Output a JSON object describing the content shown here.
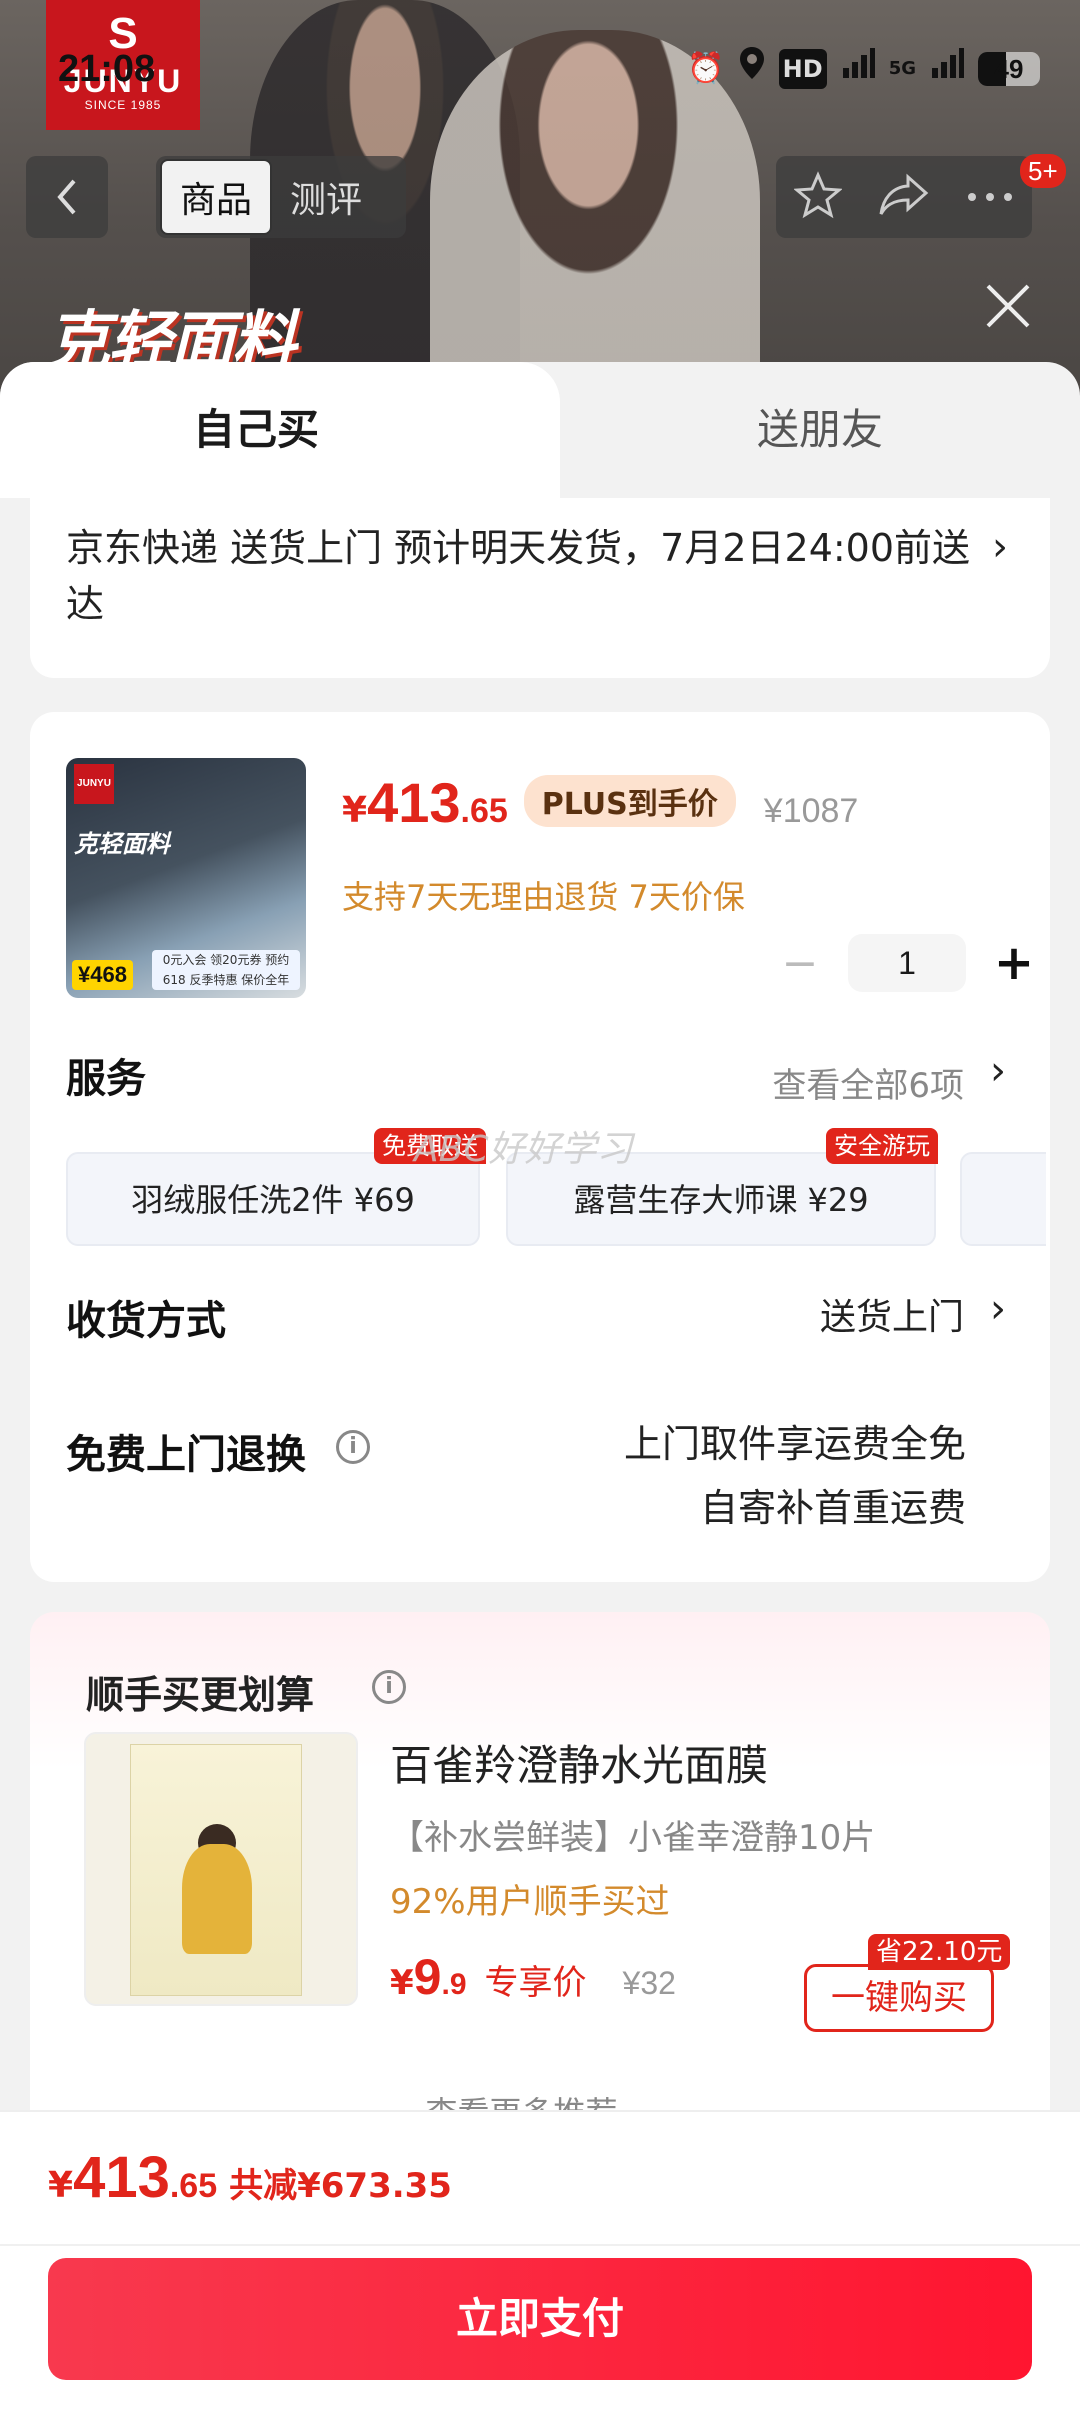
{
  "status_bar": {
    "time": "21:08",
    "network": [
      "HD",
      "5G",
      "5G"
    ],
    "battery": "49"
  },
  "brand": {
    "name": "JUNYU",
    "since": "SINCE 1985",
    "mark": "S"
  },
  "header": {
    "tabs": [
      {
        "label": "商品",
        "active": true
      },
      {
        "label": "测评",
        "active": false
      }
    ],
    "message_count": "5+",
    "banner_text": "克轻面料"
  },
  "sheet": {
    "tabs": [
      {
        "label": "自己买",
        "active": true
      },
      {
        "label": "送朋友",
        "active": false
      }
    ],
    "delivery": {
      "text": "京东快递 送货上门 预计明天发货，7月2日24:00前送达"
    }
  },
  "product": {
    "thumb": {
      "banner": "克轻面料",
      "price": "¥468",
      "strip": "0元入会 领20元券 预约618 反季特惠 保价全年"
    },
    "price": {
      "currency": "¥",
      "integer": "413",
      "decimal": ".65"
    },
    "plus_tag": "PLUS到手价",
    "original_price": "¥1087",
    "policy": "支持7天无理由退货 7天价保",
    "quantity": "1"
  },
  "services": {
    "title": "服务",
    "more": "查看全部6项",
    "items": [
      {
        "label": "羽绒服任洗2件  ¥69",
        "badge": "免费取送"
      },
      {
        "label": "露营生存大师课  ¥29",
        "badge": "安全游玩"
      }
    ],
    "watermark": "ABC好好学习"
  },
  "shipping": {
    "label": "收货方式",
    "value": "送货上门"
  },
  "free_return": {
    "label": "免费上门退换",
    "line1": "上门取件享运费全免",
    "line2": "自寄补首重运费"
  },
  "recommend": {
    "title": "顺手买更划算",
    "name": "百雀羚澄静水光面膜",
    "desc": "【补水尝鲜装】小雀幸澄静10片",
    "bought": "92%用户顺手买过",
    "price": {
      "currency": "¥",
      "integer": "9",
      "decimal": ".9"
    },
    "exclusive": "专享价",
    "original": "¥32",
    "save": "省22.10元",
    "buy_label": "一键购买",
    "more": "查看更多推荐 ⌄"
  },
  "bottom": {
    "total": {
      "currency": "¥",
      "integer": "413",
      "decimal": ".65"
    },
    "discount": "共减¥673.35",
    "pay_label": "立即支付"
  },
  "colors": {
    "accent": "#e1251b",
    "pay_button": "#ff1530",
    "policy": "#d38a2c"
  },
  "icons": [
    "back-icon",
    "star-icon",
    "share-icon",
    "more-icon",
    "close-icon",
    "chevron-right-icon",
    "info-icon",
    "minus-icon",
    "plus-icon",
    "alarm-icon",
    "location-icon",
    "signal-icon"
  ]
}
